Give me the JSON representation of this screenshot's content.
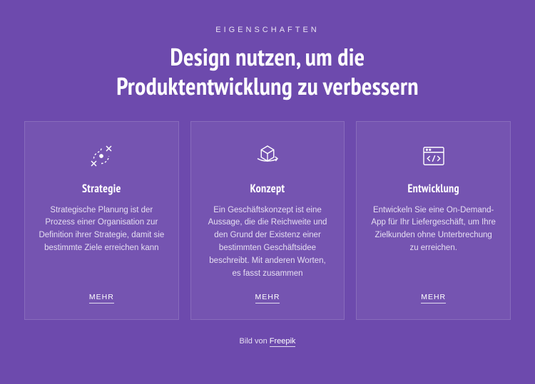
{
  "eyebrow": "EIGENSCHAFTEN",
  "heading": "Design nutzen, um die Produktentwicklung zu verbessern",
  "cards": [
    {
      "icon": "strategy-icon",
      "title": "Strategie",
      "text": "Strategische Planung ist der Prozess einer Organisation zur Definition ihrer Strategie, damit sie bestimmte Ziele erreichen kann",
      "link": "MEHR"
    },
    {
      "icon": "concept-icon",
      "title": "Konzept",
      "text": "Ein Geschäftskonzept ist eine Aussage, die die Reichweite und den Grund der Existenz einer bestimmten Geschäftsidee beschreibt. Mit anderen Worten, es fasst zusammen",
      "link": "MEHR"
    },
    {
      "icon": "development-icon",
      "title": "Entwicklung",
      "text": "Entwickeln Sie eine On-Demand-App für Ihr Liefergeschäft, um Ihre Zielkunden ohne Unterbrechung zu erreichen.",
      "link": "MEHR"
    }
  ],
  "credit": {
    "prefix": "Bild von ",
    "link": "Freepik"
  },
  "colors": {
    "bg": "#6d4aad",
    "card_bg": "rgba(255,255,255,0.06)",
    "text": "#ffffff"
  }
}
